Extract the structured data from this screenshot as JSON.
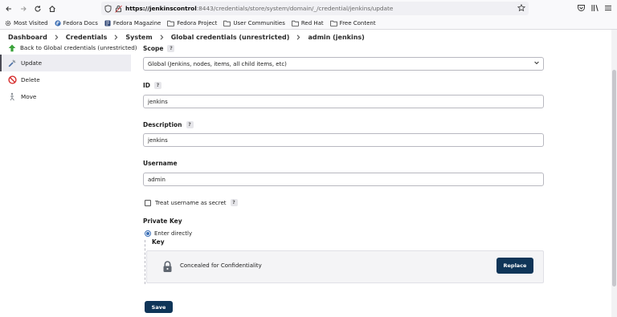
{
  "browser": {
    "url_host": "https://jenkinscontrol",
    "url_path": ":8443/credentials/store/system/domain/_/credential/jenkins/update",
    "bookmarks": [
      {
        "label": "Most Visited",
        "icon": "gear-icon"
      },
      {
        "label": "Fedora Docs",
        "icon": "fedora-icon"
      },
      {
        "label": "Fedora Magazine",
        "icon": "magazine-icon"
      },
      {
        "label": "Fedora Project",
        "icon": "folder-icon"
      },
      {
        "label": "User Communities",
        "icon": "folder-icon"
      },
      {
        "label": "Red Hat",
        "icon": "folder-icon"
      },
      {
        "label": "Free Content",
        "icon": "folder-icon"
      }
    ]
  },
  "breadcrumb": [
    "Dashboard",
    "Credentials",
    "System",
    "Global credentials (unrestricted)",
    "admin (jenkins)"
  ],
  "sidebar": {
    "items": [
      {
        "label": "Back to Global credentials (unrestricted)",
        "icon": "up-arrow-icon"
      },
      {
        "label": "Update",
        "icon": "wrench-icon"
      },
      {
        "label": "Delete",
        "icon": "no-entry-icon"
      },
      {
        "label": "Move",
        "icon": "move-icon"
      }
    ]
  },
  "form": {
    "scope_label": "Scope",
    "scope_value": "Global (Jenkins, nodes, items, all child items, etc)",
    "id_label": "ID",
    "id_value": "jenkins",
    "description_label": "Description",
    "description_value": "jenkins",
    "username_label": "Username",
    "username_value": "admin",
    "treat_secret_label": "Treat username as secret",
    "private_key_label": "Private Key",
    "enter_directly_label": "Enter directly",
    "key_label": "Key",
    "concealed_text": "Concealed for Confidentiality",
    "replace_label": "Replace",
    "save_label": "Save"
  },
  "colors": {
    "primary_button": "#0f3558",
    "radio_accent": "#3b6fb6",
    "up_arrow": "#3aa23a",
    "delete": "#d62c2c"
  }
}
